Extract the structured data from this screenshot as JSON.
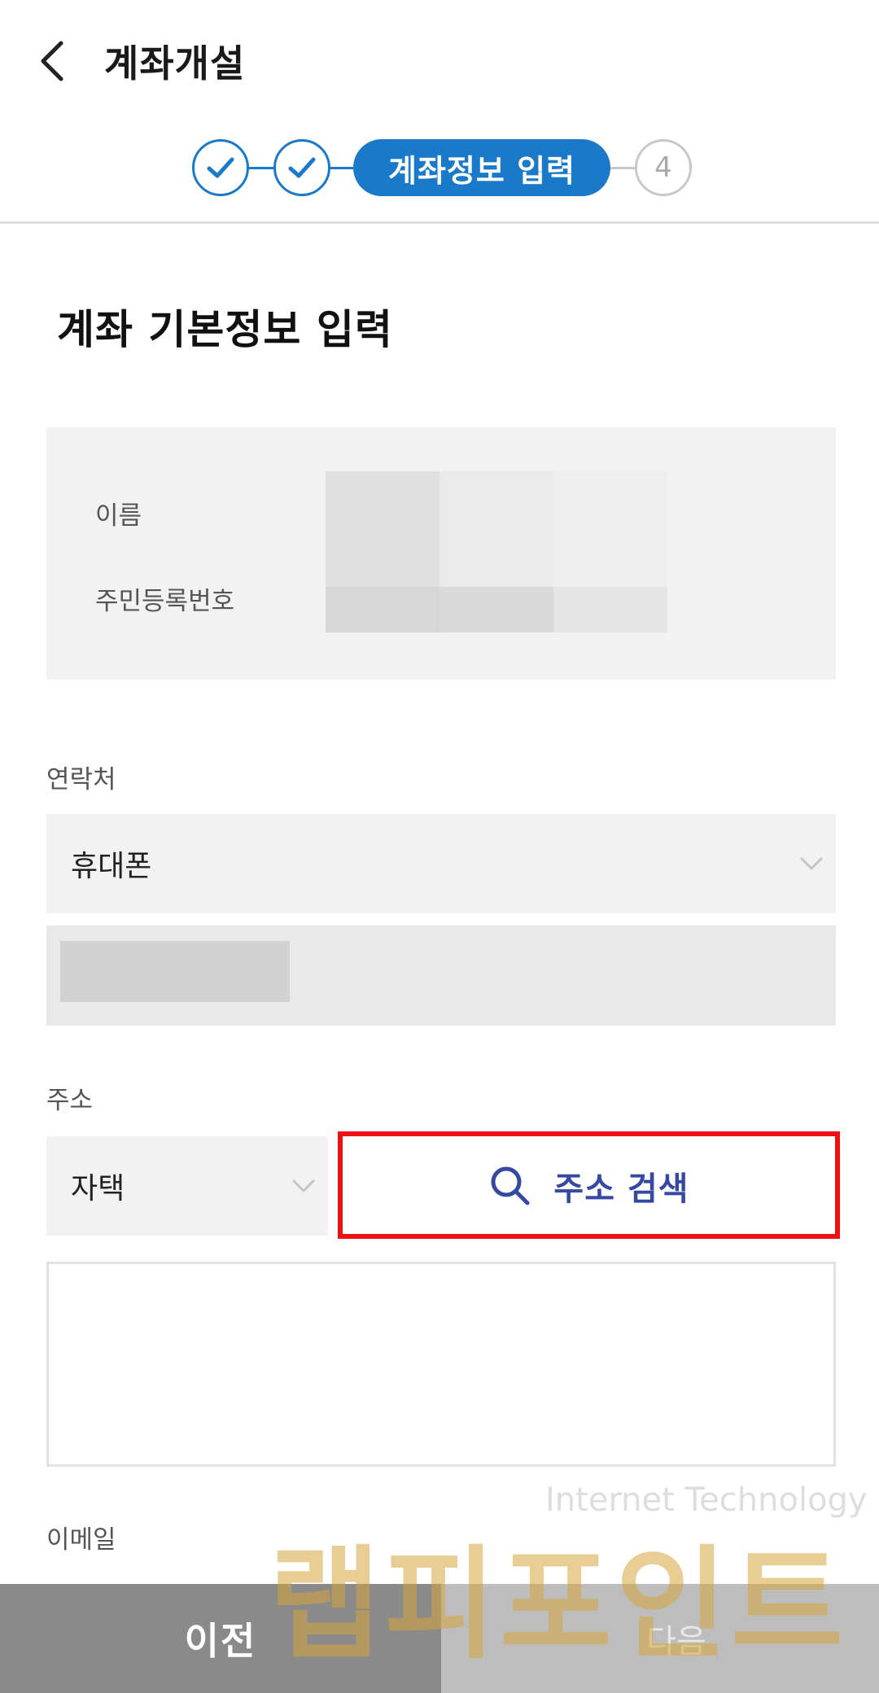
{
  "header": {
    "title": "계좌개설"
  },
  "stepper": {
    "active_label": "계좌정보 입력",
    "pending_label": "4",
    "colors": {
      "accent": "#1a7ac9",
      "inactive": "#c8c8c8"
    }
  },
  "section": {
    "title": "계좌 기본정보 입력"
  },
  "info": {
    "name_label": "이름",
    "rrn_label": "주민등록번호"
  },
  "contact": {
    "label": "연락처",
    "type_value": "휴대폰"
  },
  "address": {
    "label": "주소",
    "type_value": "자택",
    "search_label": "주소 검색",
    "search_color": "#3549a3",
    "highlight_color": "#ee1111"
  },
  "email": {
    "label": "이메일"
  },
  "bottom": {
    "prev_label": "이전",
    "next_label": "다음"
  },
  "watermark": {
    "small_text": "Internet Technology",
    "big_text": "랩피포인트"
  }
}
